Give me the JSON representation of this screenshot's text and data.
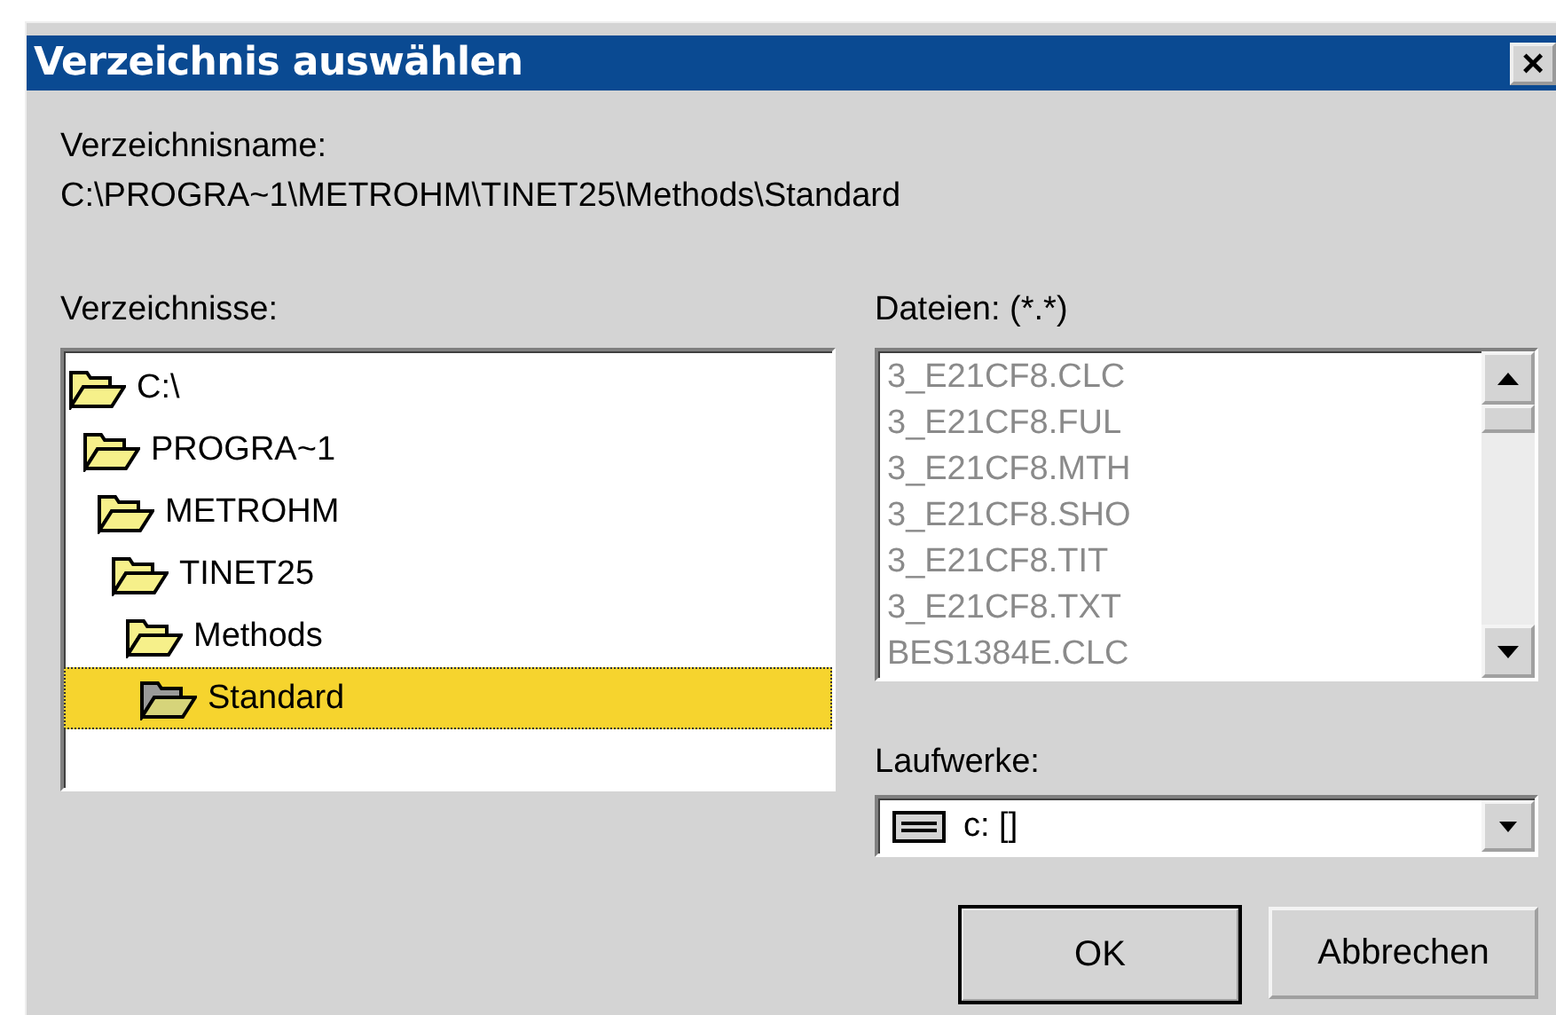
{
  "window": {
    "title": "Verzeichnis auswählen",
    "close": "×"
  },
  "directory_name": {
    "label": "Verzeichnisname:",
    "value": "C:\\PROGRA~1\\METROHM\\TINET25\\Methods\\Standard"
  },
  "directories": {
    "label": "Verzeichnisse:",
    "items": [
      {
        "name": "C:\\",
        "selected": false,
        "children": [
          {
            "name": "PROGRA~1",
            "selected": false,
            "children": [
              {
                "name": "METROHM",
                "selected": false,
                "children": [
                  {
                    "name": "TINET25",
                    "selected": false,
                    "children": [
                      {
                        "name": "Methods",
                        "selected": false,
                        "children": [
                          {
                            "name": "Standard",
                            "selected": true
                          }
                        ]
                      }
                    ]
                  }
                ]
              }
            ]
          }
        ]
      }
    ]
  },
  "files": {
    "label": "Dateien: (*.*)",
    "disabled": true,
    "items": [
      "3_E21CF8.CLC",
      "3_E21CF8.FUL",
      "3_E21CF8.MTH",
      "3_E21CF8.SHO",
      "3_E21CF8.TIT",
      "3_E21CF8.TXT",
      "BES1384E.CLC"
    ]
  },
  "drives": {
    "label": "Laufwerke:",
    "value": "c: []"
  },
  "buttons": [
    {
      "label": "OK",
      "default": true
    },
    {
      "label": "Abbrechen",
      "default": false
    }
  ]
}
